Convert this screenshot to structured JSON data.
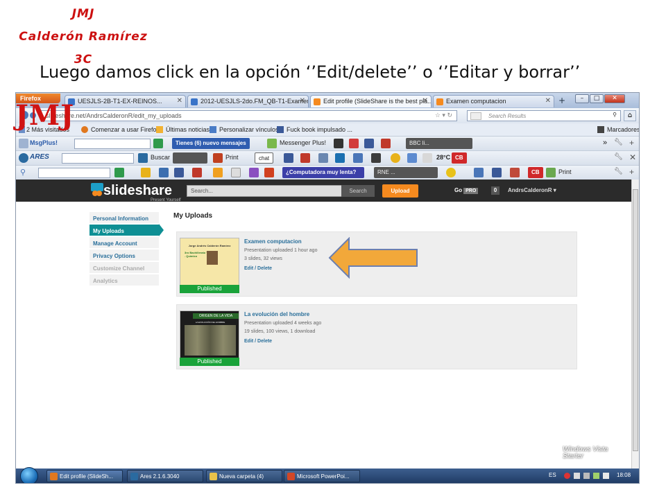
{
  "slide": {
    "author_initials": "JMJ",
    "author_name": "Calderón Ramírez",
    "group": "3C",
    "caption": "Luego damos click en la opción ‘’Edit/delete’’ o ‘’Editar y borrar’’",
    "watermark": "JMJ"
  },
  "browser": {
    "app_button": "Firefox",
    "tabs": [
      {
        "label": "UESJLS-2B-T1-EX-REINOS..."
      },
      {
        "label": "2012-UESJLS-2do.FM_QB-T1-Examen..."
      },
      {
        "label": "Edit profile (SlideShare is the best pla..."
      },
      {
        "label": "Examen computacion"
      }
    ],
    "new_tab": "+",
    "url": "slideshare.net/AndrsCalderonR/edit_my_uploads",
    "search_placeholder": "Search Results",
    "bookmarks": [
      {
        "label": "2 Más visitados"
      },
      {
        "label": "Comenzar a usar Firefox"
      },
      {
        "label": "Últimas noticias"
      },
      {
        "label": "Personalizar vínculos"
      },
      {
        "label": "Fuck book impulsado ..."
      }
    ],
    "bookmarks_menu": "Marcadores",
    "toolbar1": {
      "msgplus": "MsgPlus!",
      "messages": "Tienes (6) nuevo mensajes",
      "messenger": "Messenger Plus!",
      "radio": "BBC li..."
    },
    "toolbar2": {
      "ares": "ARES",
      "buscar": "Buscar",
      "print": "Print",
      "chat": "chat",
      "temp": "28°C",
      "cb": "CB"
    },
    "toolbar3": {
      "question": "¿Computadora muy lenta?",
      "radio": "RNE ...",
      "print": "Print"
    },
    "window_controls": [
      "–",
      "□",
      "✕"
    ]
  },
  "slideshare": {
    "logo": "slideshare",
    "tagline": "Present Yourself",
    "search_placeholder": "Search...",
    "search_button": "Search",
    "upload_button": "Upload",
    "go": "Go",
    "pro": "PRO",
    "notifications": "0",
    "username": "AndrsCalderonR",
    "sidebar": [
      {
        "label": "Personal Information"
      },
      {
        "label": "My Uploads"
      },
      {
        "label": "Manage Account"
      },
      {
        "label": "Privacy Options"
      },
      {
        "label": "Customize Channel"
      },
      {
        "label": "Analytics"
      }
    ],
    "page_title": "My Uploads",
    "uploads": [
      {
        "title": "Examen computacion",
        "meta1": "Presentation uploaded 1 hour ago",
        "meta2": "3 slides, 32 views",
        "edit": "Edit / Delete",
        "status": "Published",
        "thumb_title": "Jorge Andrés Calderón Ramírez",
        "thumb_sub": "3ro Bachillerato \"C\" . Químico"
      },
      {
        "title": "La evolución del hombre",
        "meta1": "Presentation uploaded 4 weeks ago",
        "meta2": "19 slides, 100 views, 1 download",
        "edit": "Edit / Delete",
        "status": "Published",
        "thumb_title": "ORIGEN DE LA VIDA",
        "thumb_sub": "LA EVOLUCIÓN DEL HOMBRE"
      }
    ]
  },
  "taskbar": {
    "items": [
      {
        "label": "Edit profile (SlideSh..."
      },
      {
        "label": "Ares 2.1.6.3040"
      },
      {
        "label": "Nueva carpeta (4)"
      },
      {
        "label": "Microsoft PowerPoi..."
      }
    ],
    "lang": "ES",
    "clock": "18:08",
    "os_line1": "Windows Vista",
    "os_line2": "Starter"
  },
  "colors": {
    "red_title": "#cc1010",
    "teal": "#0e8f94",
    "orange": "#f58a1f",
    "green": "#1aa33a",
    "arrow": "#f2a83a"
  }
}
